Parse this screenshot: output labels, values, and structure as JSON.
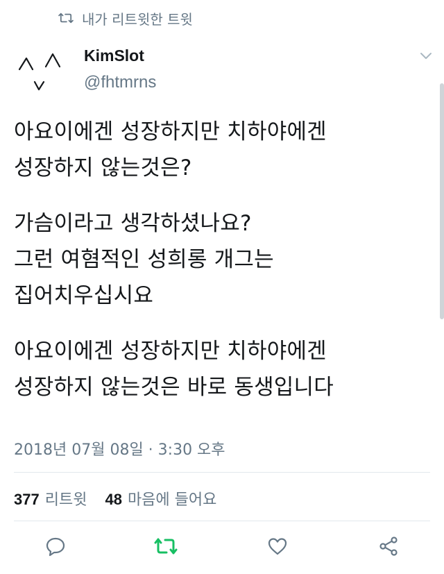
{
  "retweet_context": {
    "label": "내가 리트윗한 트윗",
    "icon": "retweet-icon"
  },
  "author": {
    "name": "KimSlot",
    "handle": "@fhtmrns",
    "avatar": "avatar-caret-face"
  },
  "tweet": {
    "lines": [
      "아요이에겐 성장하지만 치하야에겐",
      "성장하지 않는것은?",
      "",
      "가슴이라고 생각하셨나요?",
      "그런 여혐적인 성희롱 개그는",
      "집어치우십시요",
      "",
      "아요이에겐 성장하지만 치하야에겐",
      "성장하지 않는것은 바로 동생입니다"
    ],
    "timestamp": "2018년 07월 08일 · 3:30 오후"
  },
  "stats": {
    "retweets": {
      "count": "377",
      "label": "리트윗"
    },
    "likes": {
      "count": "48",
      "label": "마음에 들어요"
    }
  },
  "actions": {
    "reply": "reply-icon",
    "retweet": "retweet-icon",
    "like": "heart-icon",
    "share": "share-icon",
    "retweet_active_color": "#17bf63",
    "icon_color": "#657786"
  }
}
